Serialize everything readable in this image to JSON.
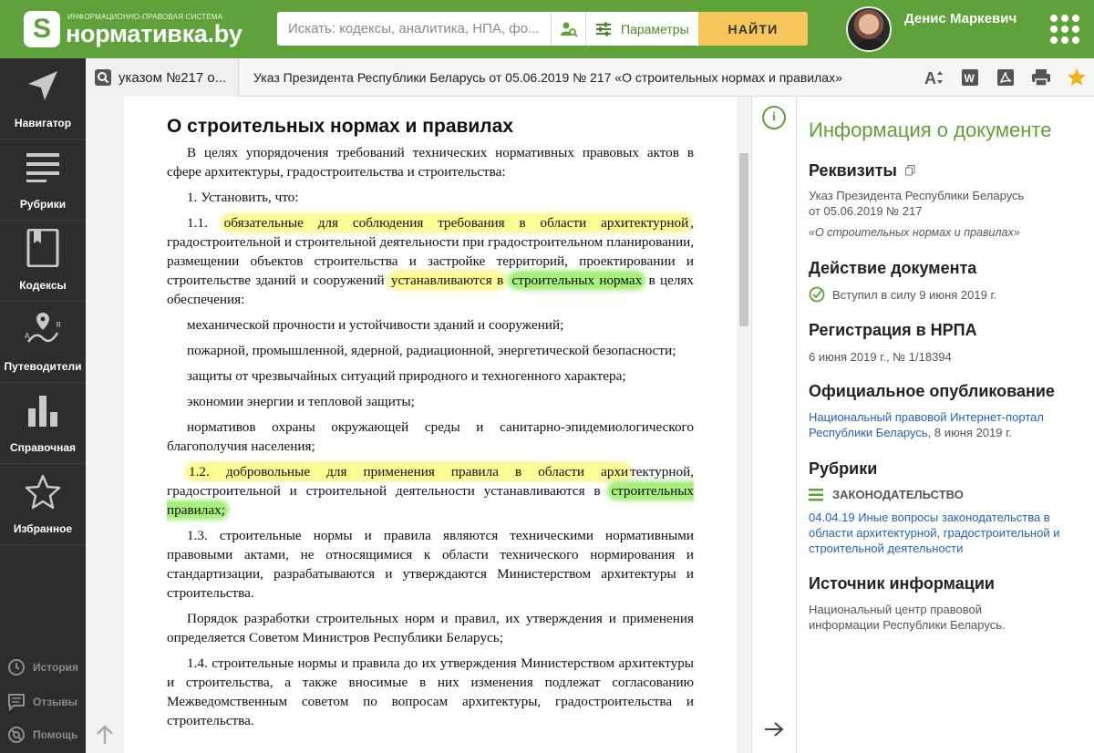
{
  "header": {
    "logo_subtitle": "ИНФОРМАЦИОННО-ПРАВОВАЯ СИСТЕМА",
    "logo_title": "нормативка.by",
    "search_placeholder": "Искать: кодексы, аналитика, НПА, фо...",
    "params_label": "Параметры",
    "find_label": "НАЙТИ",
    "user_name": "Денис Маркевич"
  },
  "sidebar": {
    "items": [
      {
        "label": "Навигатор",
        "icon": "navigator-icon"
      },
      {
        "label": "Рубрики",
        "icon": "rubrics-icon"
      },
      {
        "label": "Кодексы",
        "icon": "codes-icon"
      },
      {
        "label": "Путеводители",
        "icon": "guides-icon"
      },
      {
        "label": "Справочная",
        "icon": "reference-icon"
      },
      {
        "label": "Избранное",
        "icon": "favorites-icon"
      }
    ],
    "bottom": [
      {
        "label": "История",
        "icon": "history-icon"
      },
      {
        "label": "Отзывы",
        "icon": "feedback-icon"
      },
      {
        "label": "Помощь",
        "icon": "help-icon"
      }
    ]
  },
  "tabbar": {
    "search_query": "указом №217 о...",
    "doc_title": "Указ Президента Республики Беларусь от 05.06.2019 № 217 «О строительных нормах и правилах»"
  },
  "document": {
    "title": "О строительных нормах и правилах",
    "p1": "В целях упорядочения требований технических нормативных правовых актов в сфере архитектуры, градостроительства и строительства:",
    "p2": "1. Установить, что:",
    "p3_a": "1.1.",
    "p3_hl1": "обязательные для соблюдения требования в области архитектурной",
    "p3_b": ", градостроительной и строительной деятельности при градостроительном планировании, размещении объектов строительства и застройке территорий, проектировании и строительстве зданий и сооружений",
    "p3_hl2": "устанавливаются в",
    "p3_hlg": "строительных нормах",
    "p3_c": "в целях обеспечения:",
    "p4": "механической прочности и устойчивости зданий и сооружений;",
    "p5": "пожарной, промышленной, ядерной, радиационной, энергетической безопасности;",
    "p6": "защиты от чрезвычайных ситуаций природного и техногенного характера;",
    "p7": "экономии энергии и тепловой защиты;",
    "p8": "нормативов охраны окружающей среды и санитарно-эпидемиологического благополучия населения;",
    "p9_hl": "1.2. добровольные для применения правила в области архи",
    "p9_b": "тектурной, градостроительной и строительной деятельности устанавливаются в",
    "p9_hlg": "строительных правилах;",
    "p10": "1.3. строительные нормы и правила являются техническими нормативными правовыми актами, не относящимися к области технического нормирования и стандартизации, разрабатываются и утверждаются Министерством архитектуры и строительства.",
    "p11": "Порядок разработки строительных норм и правил, их утверждения и применения определяется Советом Министров Республики Беларусь;",
    "p12": "1.4. строительные нормы и правила до их утверждения Министерством архитектуры и строительства, а также вносимые в них изменения подлежат согласованию Межведомственным советом по вопросам архитектуры, градостроительства и строительства."
  },
  "info": {
    "title": "Информация о документе",
    "rekv_h": "Реквизиты",
    "rekv_1": "Указ Президента Республики Беларусь",
    "rekv_2": "от 05.06.2019 № 217",
    "rekv_3": "«О строительных нормах и правилах»",
    "action_h": "Действие документа",
    "action_t": "Вступил в силу 9 июня 2019 г.",
    "reg_h": "Регистрация в НРПА",
    "reg_t": "6 июня 2019 г., № 1/18394",
    "pub_h": "Официальное опубликование",
    "pub_link": "Национальный правовой Интернет-портал Республики Беларусь",
    "pub_t": ", 8 июня 2019 г.",
    "rub_h": "Рубрики",
    "rub_cat": "ЗАКОНОДАТЕЛЬСТВО",
    "rub_link": "04.04.19 Иные вопросы законодательства в области архитектурной, градостроительной и строительной деятельности",
    "src_h": "Источник информации",
    "src_t": "Национальный центр правовой информации Республики Беларусь."
  },
  "colors": {
    "brand": "#5fa13a",
    "find_button": "#f7c65a",
    "sidebar": "#2d2d2d",
    "link": "#2563b6",
    "highlight_yellow": "#fdfb93",
    "highlight_green": "#a8f07c"
  }
}
